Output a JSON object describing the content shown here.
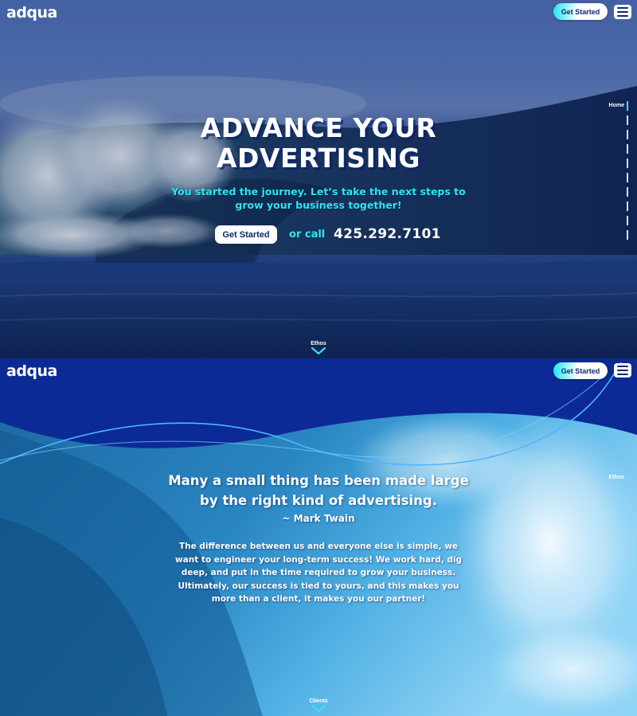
{
  "brand": {
    "logo_text": "adqua"
  },
  "header": {
    "cta_label": "Get Started",
    "menu_icon": "hamburger-menu-icon"
  },
  "hero": {
    "title_line1": "ADVANCE YOUR",
    "title_line2": "ADVERTISING",
    "subtitle_line1": "You started the journey. Let’s take the next steps to",
    "subtitle_line2": "grow your business together!",
    "cta_label": "Get Started",
    "or_call": "or call",
    "phone": "425.292.7101",
    "side_nav_label": "Home",
    "scroll_label": "Ethos"
  },
  "ethos": {
    "quote_line1": "Many a small thing has been made large",
    "quote_line2": "by the right kind of advertising.",
    "author": "~ Mark Twain",
    "body": "The difference between us and everyone else is simple, we want to engineer your long-term success! We work hard, dig deep, and put in the time required to grow your business. Ultimately, our success is tied to yours, and this makes you more than a client, it makes you our partner!",
    "side_nav_label": "Ethos",
    "scroll_label": "Clients"
  },
  "colors": {
    "accent_cyan": "#2ee6ef",
    "brand_navy": "#0b2a6f",
    "section_blue": "#0b2a96"
  }
}
